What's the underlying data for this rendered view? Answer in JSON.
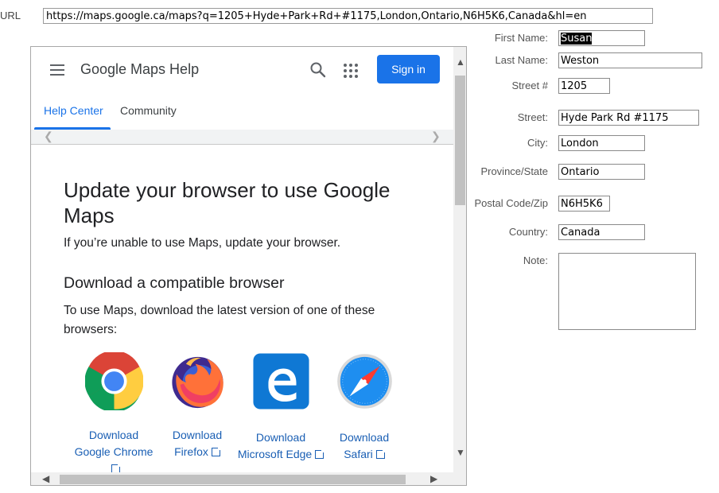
{
  "url_label": "URL",
  "url_value": "https://maps.google.ca/maps?q=1205+Hyde+Park+Rd+#1175,London,Ontario,N6H5K6,Canada&hl=en",
  "browser": {
    "app_title": "Google Maps Help",
    "sign_in": "Sign in",
    "tabs": [
      "Help Center",
      "Community"
    ],
    "heading": "Update your browser to use Google Maps",
    "intro": "If you’re unable to use Maps, update your browser.",
    "subheading": "Download a compatible browser",
    "instructions": "To use Maps, download the latest version of one of these browsers:",
    "browsers": [
      {
        "line1": "Download",
        "line2": "Google Chrome"
      },
      {
        "line1": "Download",
        "line2": "Firefox"
      },
      {
        "line1": "Download",
        "line2": "Microsoft Edge"
      },
      {
        "line1": "Download",
        "line2": "Safari"
      }
    ]
  },
  "form": {
    "first_name_label": "First Name:",
    "first_name": "Susan",
    "last_name_label": "Last Name:",
    "last_name": "Weston",
    "street_no_label": "Street #",
    "street_no": "1205",
    "street_label": "Street:",
    "street": "Hyde Park Rd #1175",
    "city_label": "City:",
    "city": "London",
    "province_label": "Province/State",
    "province": "Ontario",
    "postal_label": "Postal Code/Zip",
    "postal": "N6H5K6",
    "country_label": "Country:",
    "country": "Canada",
    "note_label": "Note:",
    "note": ""
  },
  "colors": {
    "accent": "#1a73e8",
    "link": "#1a5fb4"
  },
  "icons": [
    "menu-icon",
    "search-icon",
    "apps-grid-icon",
    "chrome-logo",
    "firefox-logo",
    "edge-logo",
    "safari-logo",
    "external-link-icon"
  ]
}
